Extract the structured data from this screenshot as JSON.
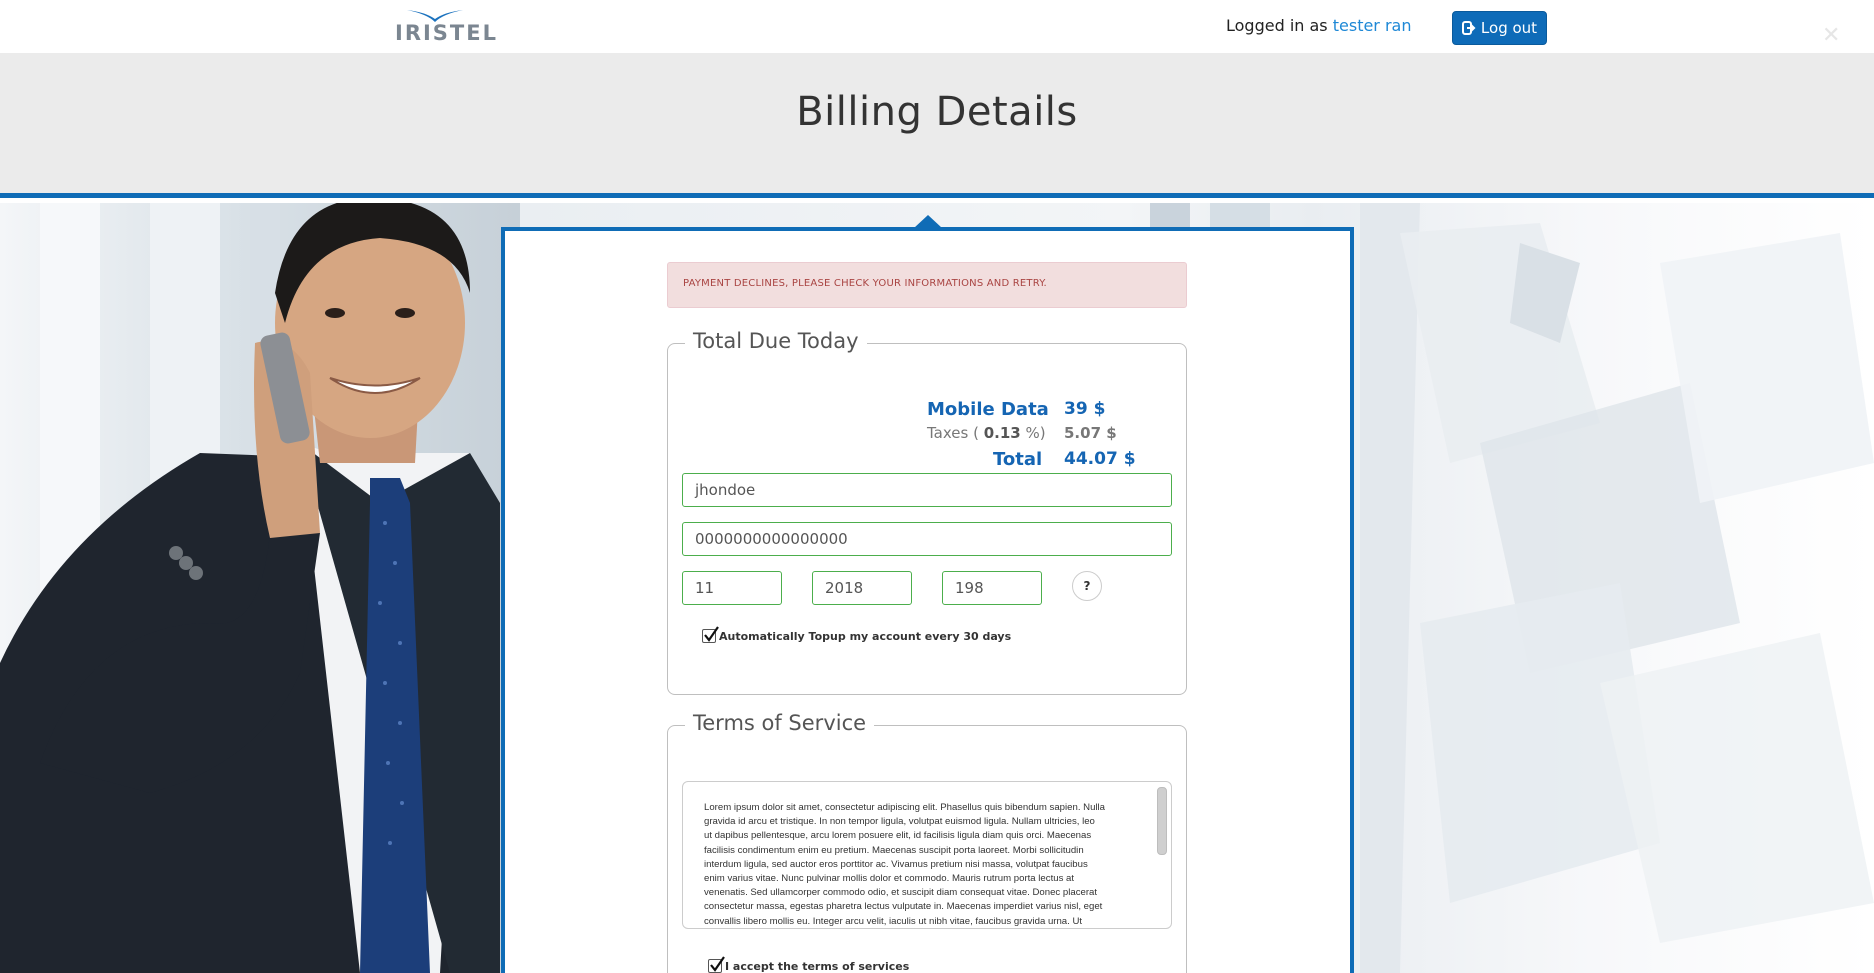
{
  "header": {
    "logo_text": "IRISTEL",
    "logged_in_prefix": "Logged in as",
    "username": "tester ran",
    "logout_label": "Log out"
  },
  "page": {
    "title": "Billing Details"
  },
  "alert": {
    "message": "PAYMENT DECLINES, PLEASE CHECK YOUR INFORMATIONS AND RETRY."
  },
  "total_due": {
    "legend": "Total Due Today",
    "plan_label": "Mobile Data",
    "plan_value": "39 $",
    "taxes_label_prefix": "Taxes (",
    "taxes_rate": "0.13",
    "taxes_label_suffix": "%)",
    "taxes_value": "5.07 $",
    "total_label": "Total",
    "total_value": "44.07 $"
  },
  "form": {
    "name_value": "jhondoe",
    "card_number_value": "0000000000000000",
    "exp_month_value": "11",
    "exp_year_value": "2018",
    "cvv_value": "198",
    "help_label": "?",
    "auto_topup_label": "Automatically Topup my account every 30 days",
    "auto_topup_checked": true
  },
  "terms": {
    "legend": "Terms of Service",
    "lines": [
      "Lorem ipsum dolor sit amet, consectetur adipiscing elit. Phasellus quis bibendum sapien. Nulla",
      "gravida id arcu et tristique. In non tempor ligula, volutpat euismod ligula. Nullam ultricies, leo",
      "ut dapibus pellentesque, arcu lorem posuere elit, id facilisis ligula diam quis orci. Maecenas",
      "facilisis condimentum enim eu pretium. Maecenas suscipit porta laoreet. Morbi sollicitudin",
      "interdum ligula, sed auctor eros porttitor ac. Vivamus pretium nisi massa, volutpat faucibus",
      "enim varius vitae. Nunc pulvinar mollis dolor et commodo. Mauris rutrum porta lectus at",
      "venenatis. Sed ullamcorper commodo odio, et suscipit diam consequat vitae. Donec placerat",
      "consectetur massa, egestas pharetra lectus vulputate in. Maecenas imperdiet varius nisl, eget",
      "convallis libero mollis eu. Integer arcu velit, iaculis ut nibh vitae, faucibus gravida urna. Ut"
    ],
    "accept_label": "I accept the terms of services",
    "accept_checked": true
  },
  "colors": {
    "brand_blue": "#0f6cb6",
    "link_blue": "#1e88d6",
    "alert_bg": "#f2dede",
    "alert_text": "#a94442",
    "valid_green": "#4cae4c"
  }
}
